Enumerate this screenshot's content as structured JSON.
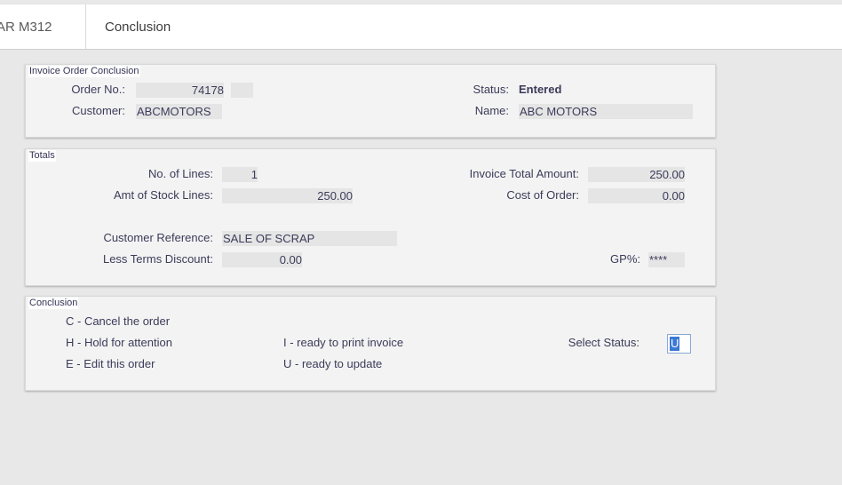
{
  "header": {
    "code": "AR M312",
    "title": "Conclusion"
  },
  "order_panel": {
    "legend": "Invoice Order Conclusion",
    "order_no_label": "Order No.:",
    "order_no": "74178",
    "customer_label": "Customer:",
    "customer": "ABCMOTORS",
    "status_label": "Status:",
    "status": "Entered",
    "name_label": "Name:",
    "name": "ABC MOTORS"
  },
  "totals_panel": {
    "legend": "Totals",
    "lines_label": "No. of Lines:",
    "lines": "1",
    "stock_label": "Amt of Stock Lines:",
    "stock": "250.00",
    "invoice_total_label": "Invoice Total Amount:",
    "invoice_total": "250.00",
    "cost_label": "Cost of Order:",
    "cost": "0.00",
    "cust_ref_label": "Customer Reference:",
    "cust_ref": "SALE OF SCRAP",
    "discount_label": "Less Terms Discount:",
    "discount": "0.00",
    "gp_label": "GP%:",
    "gp": "****"
  },
  "conclusion_panel": {
    "legend": "Conclusion",
    "options": [
      "C  - Cancel the order",
      "H  - Hold for attention",
      "E  - Edit this order",
      "I  - ready to print invoice",
      "U  - ready to update"
    ],
    "select_label": "Select Status:",
    "select_value": "U"
  }
}
